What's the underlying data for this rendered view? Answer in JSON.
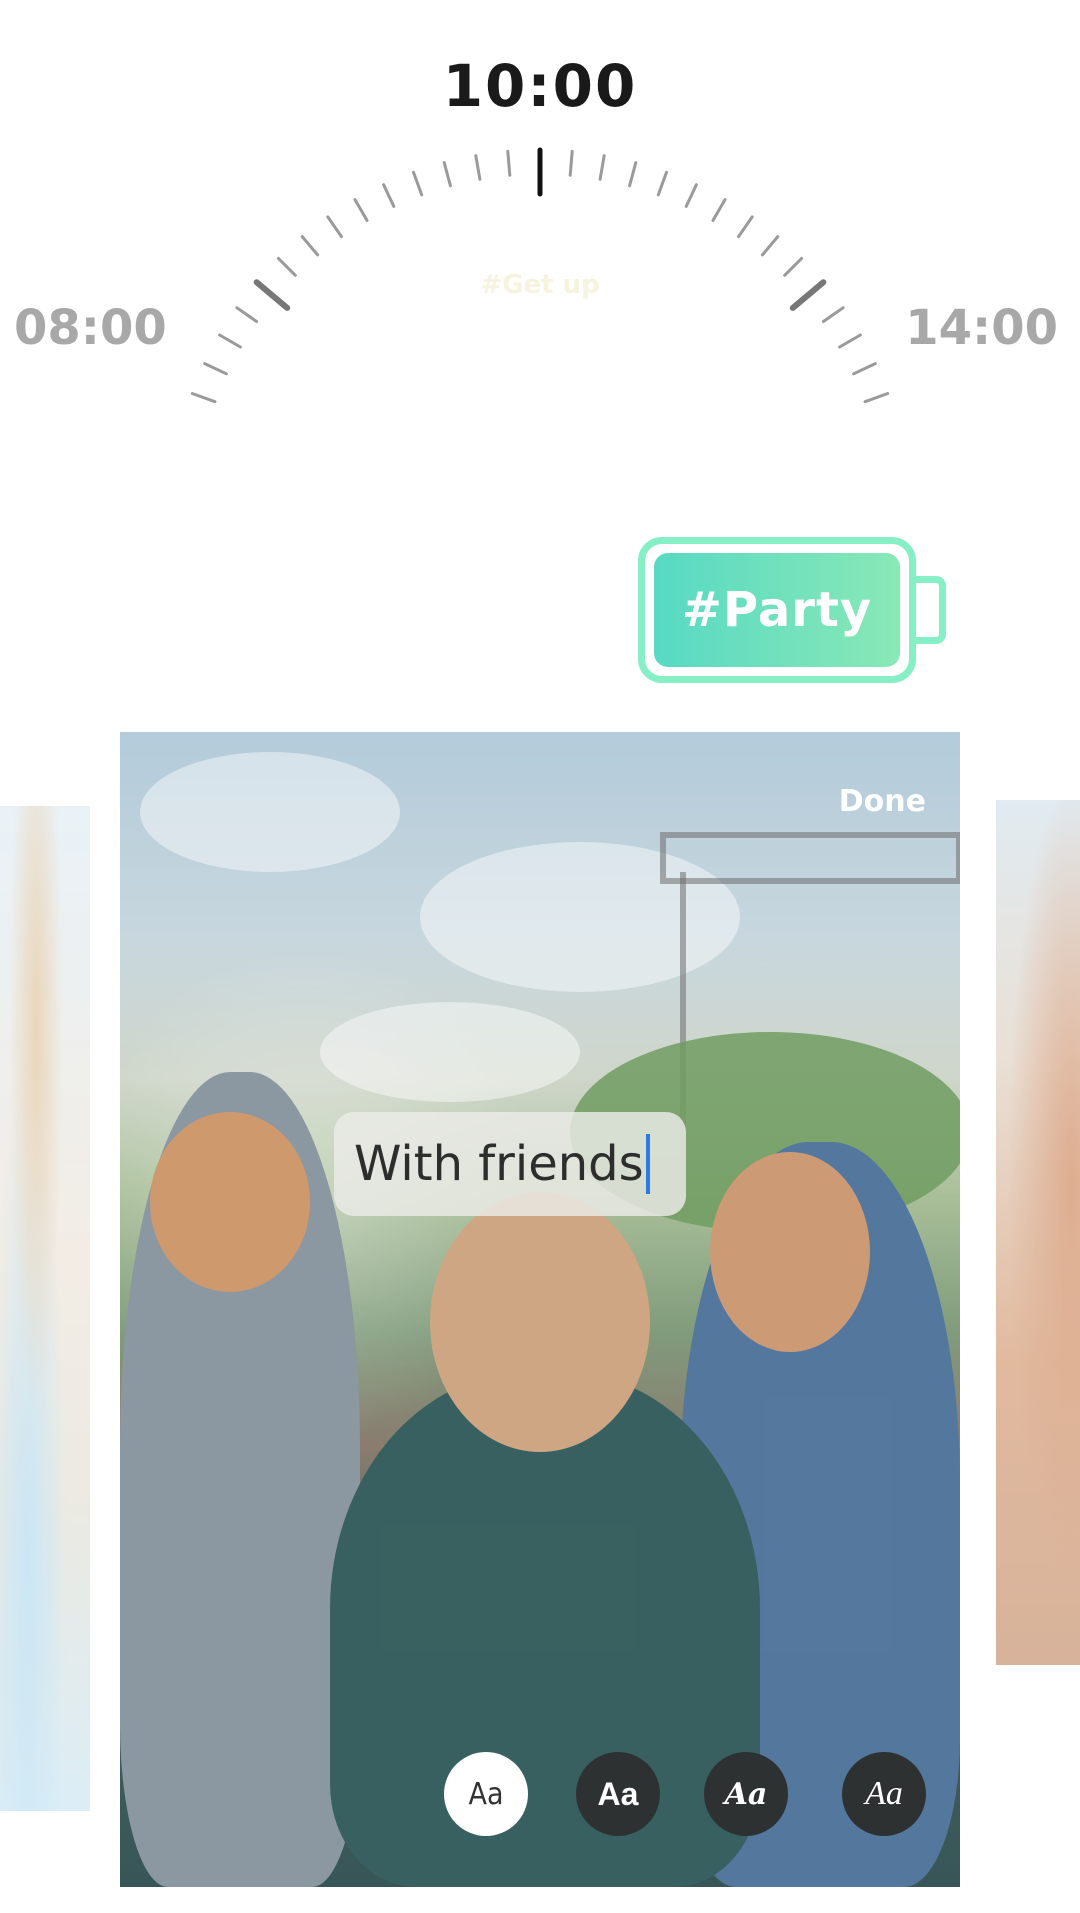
{
  "dial": {
    "current_time": "10:00",
    "start_time": "08:00",
    "end_time": "14:00",
    "faint_label": "#Get up"
  },
  "tag": {
    "label": "#Party",
    "colors": {
      "border": "#86efc5",
      "fill_start": "#57d9c3",
      "fill_end": "#89e8b6"
    }
  },
  "editor": {
    "done_label": "Done",
    "text_value": "With friends",
    "caret_color": "#2a7be4"
  },
  "font_options": [
    {
      "label": "Aa",
      "selected": true
    },
    {
      "label": "Aa",
      "selected": false
    },
    {
      "label": "Aa",
      "selected": false
    },
    {
      "label": "Aa",
      "selected": false
    }
  ]
}
